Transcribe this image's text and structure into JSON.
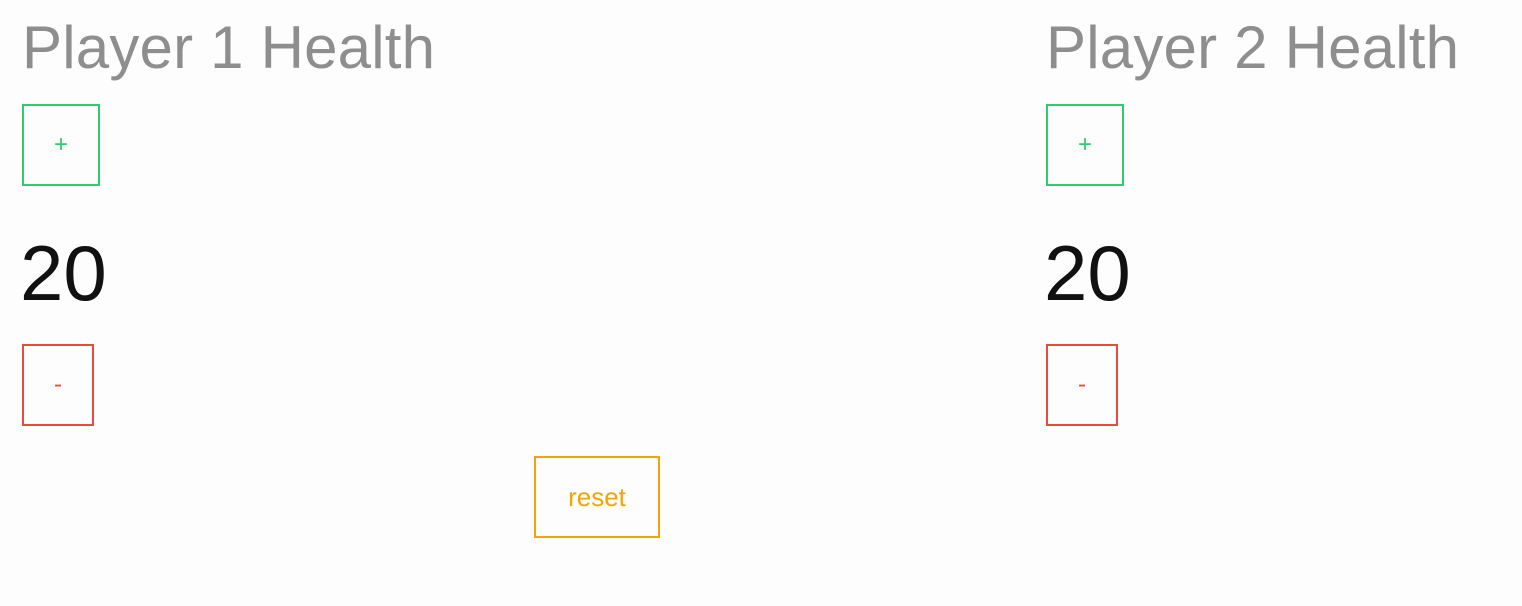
{
  "colors": {
    "title": "#8e8e8e",
    "value": "#111111",
    "plus": "#2ecc71",
    "minus": "#e74c3c",
    "reset": "#f5a500",
    "background": "#fdfdfd"
  },
  "players": [
    {
      "title": "Player 1 Health",
      "health": "20",
      "increment_label": "+",
      "decrement_label": "-"
    },
    {
      "title": "Player 2 Health",
      "health": "20",
      "increment_label": "+",
      "decrement_label": "-"
    }
  ],
  "reset_label": "reset"
}
